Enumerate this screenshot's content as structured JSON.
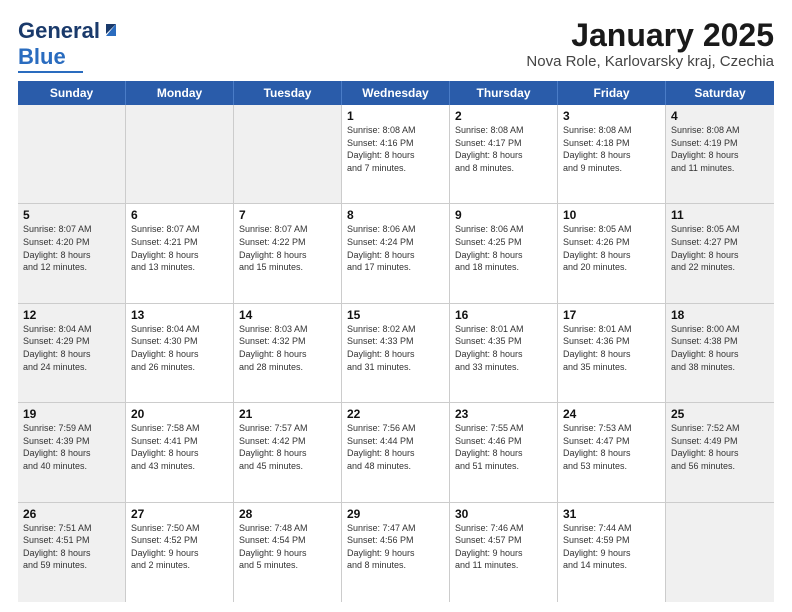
{
  "header": {
    "logo_general": "General",
    "logo_blue": "Blue",
    "month_title": "January 2025",
    "location": "Nova Role, Karlovarsky kraj, Czechia"
  },
  "weekdays": [
    "Sunday",
    "Monday",
    "Tuesday",
    "Wednesday",
    "Thursday",
    "Friday",
    "Saturday"
  ],
  "weeks": [
    [
      {
        "day": "",
        "info": "",
        "shaded": true
      },
      {
        "day": "",
        "info": "",
        "shaded": true
      },
      {
        "day": "",
        "info": "",
        "shaded": true
      },
      {
        "day": "1",
        "info": "Sunrise: 8:08 AM\nSunset: 4:16 PM\nDaylight: 8 hours\nand 7 minutes.",
        "shaded": false
      },
      {
        "day": "2",
        "info": "Sunrise: 8:08 AM\nSunset: 4:17 PM\nDaylight: 8 hours\nand 8 minutes.",
        "shaded": false
      },
      {
        "day": "3",
        "info": "Sunrise: 8:08 AM\nSunset: 4:18 PM\nDaylight: 8 hours\nand 9 minutes.",
        "shaded": false
      },
      {
        "day": "4",
        "info": "Sunrise: 8:08 AM\nSunset: 4:19 PM\nDaylight: 8 hours\nand 11 minutes.",
        "shaded": true
      }
    ],
    [
      {
        "day": "5",
        "info": "Sunrise: 8:07 AM\nSunset: 4:20 PM\nDaylight: 8 hours\nand 12 minutes.",
        "shaded": true
      },
      {
        "day": "6",
        "info": "Sunrise: 8:07 AM\nSunset: 4:21 PM\nDaylight: 8 hours\nand 13 minutes.",
        "shaded": false
      },
      {
        "day": "7",
        "info": "Sunrise: 8:07 AM\nSunset: 4:22 PM\nDaylight: 8 hours\nand 15 minutes.",
        "shaded": false
      },
      {
        "day": "8",
        "info": "Sunrise: 8:06 AM\nSunset: 4:24 PM\nDaylight: 8 hours\nand 17 minutes.",
        "shaded": false
      },
      {
        "day": "9",
        "info": "Sunrise: 8:06 AM\nSunset: 4:25 PM\nDaylight: 8 hours\nand 18 minutes.",
        "shaded": false
      },
      {
        "day": "10",
        "info": "Sunrise: 8:05 AM\nSunset: 4:26 PM\nDaylight: 8 hours\nand 20 minutes.",
        "shaded": false
      },
      {
        "day": "11",
        "info": "Sunrise: 8:05 AM\nSunset: 4:27 PM\nDaylight: 8 hours\nand 22 minutes.",
        "shaded": true
      }
    ],
    [
      {
        "day": "12",
        "info": "Sunrise: 8:04 AM\nSunset: 4:29 PM\nDaylight: 8 hours\nand 24 minutes.",
        "shaded": true
      },
      {
        "day": "13",
        "info": "Sunrise: 8:04 AM\nSunset: 4:30 PM\nDaylight: 8 hours\nand 26 minutes.",
        "shaded": false
      },
      {
        "day": "14",
        "info": "Sunrise: 8:03 AM\nSunset: 4:32 PM\nDaylight: 8 hours\nand 28 minutes.",
        "shaded": false
      },
      {
        "day": "15",
        "info": "Sunrise: 8:02 AM\nSunset: 4:33 PM\nDaylight: 8 hours\nand 31 minutes.",
        "shaded": false
      },
      {
        "day": "16",
        "info": "Sunrise: 8:01 AM\nSunset: 4:35 PM\nDaylight: 8 hours\nand 33 minutes.",
        "shaded": false
      },
      {
        "day": "17",
        "info": "Sunrise: 8:01 AM\nSunset: 4:36 PM\nDaylight: 8 hours\nand 35 minutes.",
        "shaded": false
      },
      {
        "day": "18",
        "info": "Sunrise: 8:00 AM\nSunset: 4:38 PM\nDaylight: 8 hours\nand 38 minutes.",
        "shaded": true
      }
    ],
    [
      {
        "day": "19",
        "info": "Sunrise: 7:59 AM\nSunset: 4:39 PM\nDaylight: 8 hours\nand 40 minutes.",
        "shaded": true
      },
      {
        "day": "20",
        "info": "Sunrise: 7:58 AM\nSunset: 4:41 PM\nDaylight: 8 hours\nand 43 minutes.",
        "shaded": false
      },
      {
        "day": "21",
        "info": "Sunrise: 7:57 AM\nSunset: 4:42 PM\nDaylight: 8 hours\nand 45 minutes.",
        "shaded": false
      },
      {
        "day": "22",
        "info": "Sunrise: 7:56 AM\nSunset: 4:44 PM\nDaylight: 8 hours\nand 48 minutes.",
        "shaded": false
      },
      {
        "day": "23",
        "info": "Sunrise: 7:55 AM\nSunset: 4:46 PM\nDaylight: 8 hours\nand 51 minutes.",
        "shaded": false
      },
      {
        "day": "24",
        "info": "Sunrise: 7:53 AM\nSunset: 4:47 PM\nDaylight: 8 hours\nand 53 minutes.",
        "shaded": false
      },
      {
        "day": "25",
        "info": "Sunrise: 7:52 AM\nSunset: 4:49 PM\nDaylight: 8 hours\nand 56 minutes.",
        "shaded": true
      }
    ],
    [
      {
        "day": "26",
        "info": "Sunrise: 7:51 AM\nSunset: 4:51 PM\nDaylight: 8 hours\nand 59 minutes.",
        "shaded": true
      },
      {
        "day": "27",
        "info": "Sunrise: 7:50 AM\nSunset: 4:52 PM\nDaylight: 9 hours\nand 2 minutes.",
        "shaded": false
      },
      {
        "day": "28",
        "info": "Sunrise: 7:48 AM\nSunset: 4:54 PM\nDaylight: 9 hours\nand 5 minutes.",
        "shaded": false
      },
      {
        "day": "29",
        "info": "Sunrise: 7:47 AM\nSunset: 4:56 PM\nDaylight: 9 hours\nand 8 minutes.",
        "shaded": false
      },
      {
        "day": "30",
        "info": "Sunrise: 7:46 AM\nSunset: 4:57 PM\nDaylight: 9 hours\nand 11 minutes.",
        "shaded": false
      },
      {
        "day": "31",
        "info": "Sunrise: 7:44 AM\nSunset: 4:59 PM\nDaylight: 9 hours\nand 14 minutes.",
        "shaded": false
      },
      {
        "day": "",
        "info": "",
        "shaded": true
      }
    ]
  ]
}
